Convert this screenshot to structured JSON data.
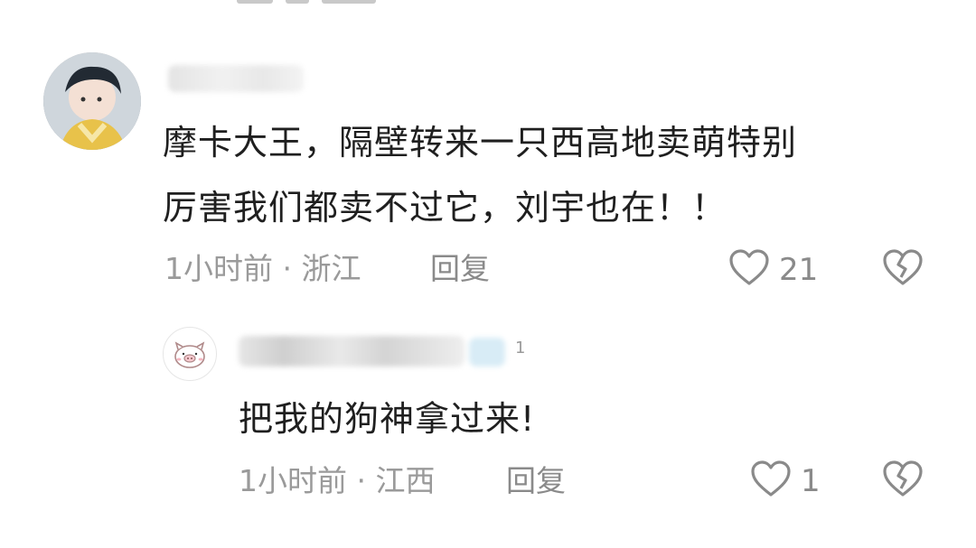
{
  "comment": {
    "text_line1": "摩卡大王，隔壁转来一只西高地卖萌特别",
    "text_line2": "厉害我们都卖不过它，刘宇也在！！",
    "time": "1小时前",
    "separator": "·",
    "location": "浙江",
    "reply_label": "回复",
    "like_count": "21",
    "avatar_icon": "user-avatar",
    "like_icon": "heart-outline-icon",
    "dislike_icon": "broken-heart-icon"
  },
  "reply": {
    "level_badge": "1",
    "text": "把我的狗神拿过来!",
    "time": "1小时前",
    "separator": "·",
    "location": "江西",
    "reply_label": "回复",
    "like_count": "1",
    "avatar_icon": "pig-avatar-icon",
    "like_icon": "heart-outline-icon",
    "dislike_icon": "broken-heart-icon"
  },
  "colors": {
    "text": "#1f1f1f",
    "meta": "#9a9a9a",
    "icon": "#8a8a8a",
    "background": "#ffffff"
  }
}
